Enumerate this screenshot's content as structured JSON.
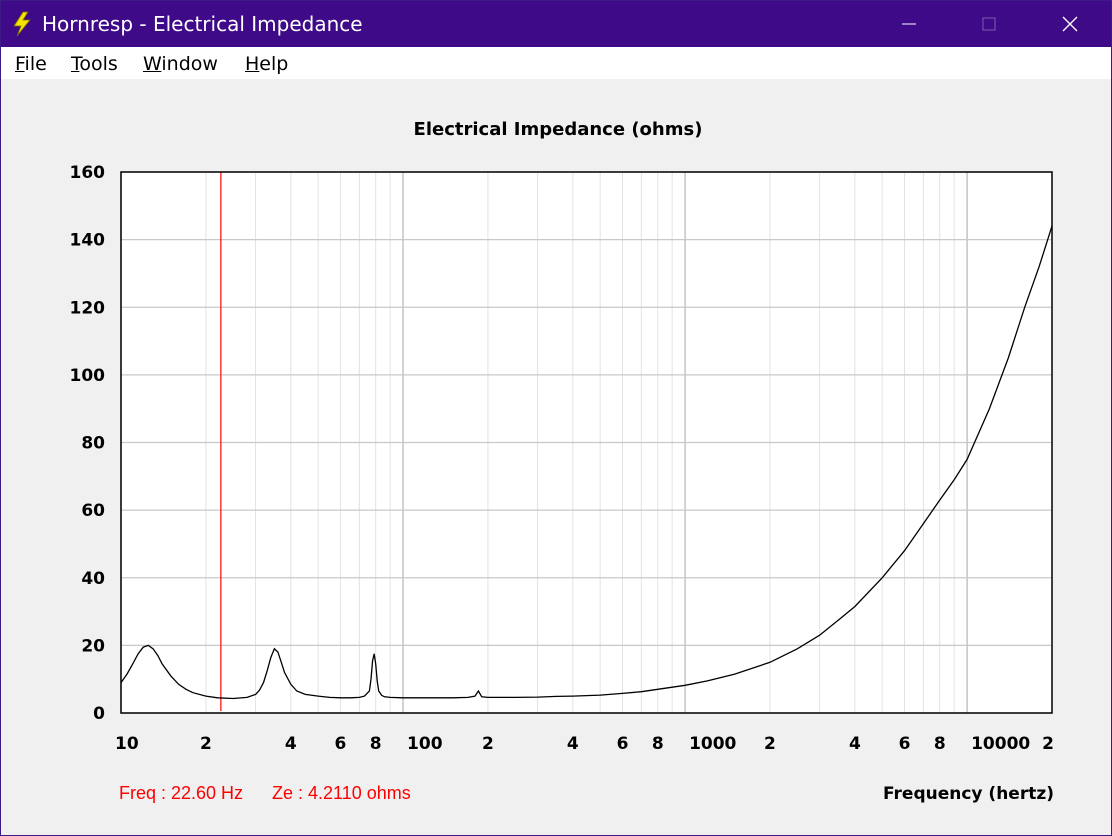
{
  "window": {
    "title": "Hornresp - Electrical Impedance",
    "app_icon": "lightning-bolt-icon",
    "controls": [
      "minimize-icon",
      "maximize-icon",
      "close-icon"
    ]
  },
  "menu": {
    "items": [
      {
        "label": "File"
      },
      {
        "label": "Tools"
      },
      {
        "label": "Window"
      },
      {
        "label": "Help"
      }
    ]
  },
  "readout": {
    "freq": "Freq : 22.60 Hz",
    "ze": "Ze : 4.2110 ohms"
  },
  "colors": {
    "titlebar": "#3f0a87",
    "curve": "#000000",
    "cursor": "#ff0000",
    "grid": "#c8c8c8"
  },
  "chart_data": {
    "type": "line",
    "title": "Electrical Impedance (ohms)",
    "xlabel": "Frequency (hertz)",
    "ylabel": "",
    "xscale": "log",
    "xlim": [
      10,
      20000
    ],
    "ylim": [
      0,
      160
    ],
    "grid": true,
    "yticks": [
      0,
      20,
      40,
      60,
      80,
      100,
      120,
      140,
      160
    ],
    "xtick_labels": [
      {
        "value": 10,
        "label": "10"
      },
      {
        "value": 20,
        "label": "2"
      },
      {
        "value": 40,
        "label": "4"
      },
      {
        "value": 60,
        "label": "6"
      },
      {
        "value": 80,
        "label": "8"
      },
      {
        "value": 100,
        "label": "100"
      },
      {
        "value": 200,
        "label": "2"
      },
      {
        "value": 400,
        "label": "4"
      },
      {
        "value": 600,
        "label": "6"
      },
      {
        "value": 800,
        "label": "8"
      },
      {
        "value": 1000,
        "label": "1000"
      },
      {
        "value": 2000,
        "label": "2"
      },
      {
        "value": 4000,
        "label": "4"
      },
      {
        "value": 6000,
        "label": "6"
      },
      {
        "value": 8000,
        "label": "8"
      },
      {
        "value": 10000,
        "label": "10000"
      },
      {
        "value": 20000,
        "label": "2"
      }
    ],
    "cursor_x": 22.6,
    "series": [
      {
        "x": [
          10,
          10.5,
          11,
          11.5,
          12,
          12.5,
          13,
          13.5,
          14,
          15,
          16,
          17,
          18,
          20,
          22,
          25,
          28,
          30,
          31,
          32,
          33,
          34,
          35,
          36,
          37,
          38,
          40,
          42,
          45,
          50,
          55,
          60,
          65,
          70,
          73,
          76,
          77,
          78,
          79,
          80,
          81,
          82,
          84,
          86,
          90,
          100,
          120,
          150,
          170,
          180,
          185,
          190,
          200,
          250,
          300,
          350,
          400,
          500,
          600,
          700,
          800,
          1000,
          1200,
          1500,
          2000,
          2500,
          3000,
          3500,
          4000,
          5000,
          6000,
          7000,
          8000,
          9000,
          10000,
          12000,
          14000,
          16000,
          18000,
          20000
        ],
        "y": [
          9.0,
          11.5,
          14.5,
          17.5,
          19.5,
          20.0,
          19.0,
          17.0,
          14.5,
          11.0,
          8.5,
          7.0,
          6.0,
          5.0,
          4.5,
          4.3,
          4.6,
          5.5,
          6.8,
          9.0,
          12.5,
          16.5,
          19.0,
          18.0,
          15.0,
          12.0,
          8.5,
          6.5,
          5.5,
          5.0,
          4.6,
          4.5,
          4.5,
          4.6,
          5.0,
          6.5,
          10.0,
          15.5,
          17.5,
          14.5,
          9.5,
          6.5,
          5.2,
          4.8,
          4.6,
          4.5,
          4.5,
          4.5,
          4.6,
          5.0,
          6.5,
          4.8,
          4.6,
          4.6,
          4.7,
          4.9,
          5.0,
          5.3,
          5.8,
          6.3,
          7.0,
          8.2,
          9.5,
          11.5,
          15.0,
          19.0,
          23.0,
          27.5,
          31.5,
          40.0,
          48.0,
          56.0,
          63.0,
          69.0,
          75.0,
          90.0,
          105.0,
          120.0,
          132.0,
          144.0
        ]
      }
    ]
  }
}
